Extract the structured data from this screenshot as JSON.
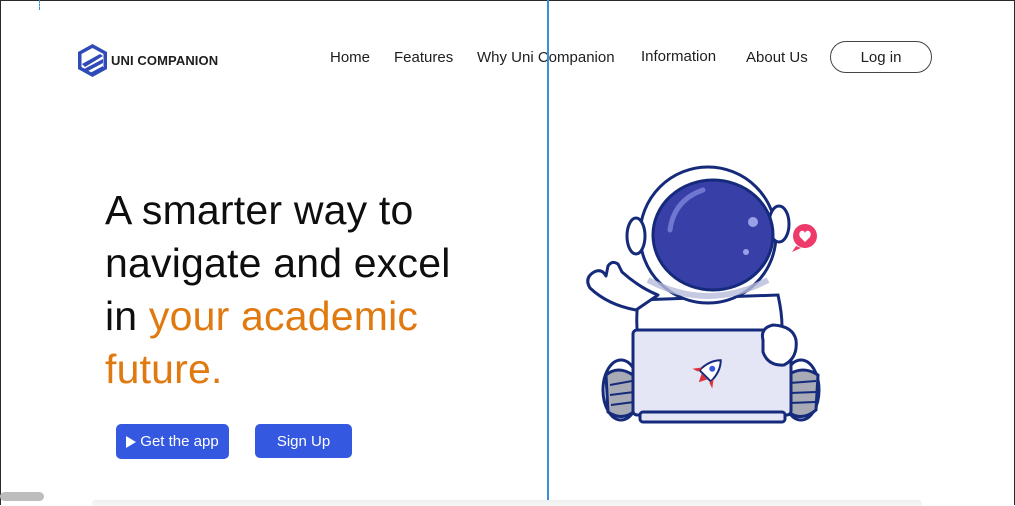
{
  "brand": {
    "name": "UNI COMPANION",
    "icon": "hexagon-logo-icon",
    "color": "#2f4bb8"
  },
  "nav": {
    "items": [
      {
        "label": "Home"
      },
      {
        "label": "Features"
      },
      {
        "label": "Why Uni Companion"
      },
      {
        "label": "Information"
      },
      {
        "label": "About Us"
      }
    ],
    "login_label": "Log in"
  },
  "hero": {
    "line1": "A smarter way to",
    "line2": "navigate and excel",
    "line3_plain": "in ",
    "line3_accent": "your academic",
    "line4_accent": "future.",
    "accent_color": "#e07a10"
  },
  "actions": {
    "get_app_label": "Get the app",
    "get_app_icon": "play-store-icon",
    "signup_label": "Sign Up",
    "button_color": "#3558e0"
  },
  "illustration": {
    "subject": "astronaut-with-laptop",
    "badge_icon": "heart-icon",
    "laptop_icon": "rocket-icon"
  }
}
